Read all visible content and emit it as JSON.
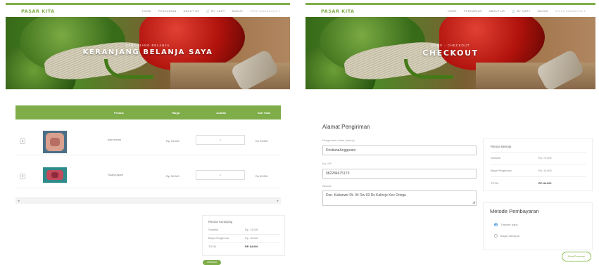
{
  "nav": {
    "brand": "PASAR KITA",
    "items": [
      "HOME",
      "PENCARIAN",
      "ABOUT US",
      "MY CART",
      "MASUK"
    ],
    "user": "KHISTIANAANGGA ▾"
  },
  "cart": {
    "hero_sub": "KERANJANG BELANJA",
    "hero_title": "KERANJANG BELANJA SAYA",
    "columns": [
      "Produk",
      "Harga",
      "Jumlah",
      "Sub Total"
    ],
    "rows": [
      {
        "remove": "x",
        "name": "Ikan merah",
        "price": "Rp. 24.000",
        "qty": "1",
        "subtotal": "Rp 24.000"
      },
      {
        "remove": "x",
        "name": "Tulang ayam",
        "price": "Rp. 50.000",
        "qty": "1",
        "subtotal": "Rp 50.000"
      }
    ],
    "scroll_left": "◂",
    "scroll_right": "▸",
    "summary": {
      "heading": "Rincian Keranjang",
      "rows": [
        {
          "label": "Subtotal",
          "value": "Rp. 74.000"
        },
        {
          "label": "Biaya Pengiriman",
          "value": "Rp. 10.000"
        },
        {
          "label": "TOTAL",
          "value": "RP. 84.000"
        }
      ]
    },
    "checkout_button": "checkout"
  },
  "checkout": {
    "hero_sub": "HOME - CHECKOUT",
    "hero_title": "CHECKOUT",
    "form_title": "Alamat Pengiriman",
    "fields": [
      {
        "label": "Pengiriman untuk (nama):",
        "value": "KristianaAnggarani"
      },
      {
        "label": "No. HP:",
        "value": "082284675170"
      }
    ],
    "address": {
      "label": "Alamat:",
      "value": "Dsn. Kalianwe Rt. 04 Rw 03 Ds Kalirejo Kec Dringu"
    },
    "summary": {
      "heading": "Rincian Belanja",
      "rows": [
        {
          "label": "Subtotal",
          "value": "Rp. 74.000"
        },
        {
          "label": "Biaya Pengiriman",
          "value": "Rp. 10.000"
        },
        {
          "label": "TOTAL",
          "value": "RP. 84.000"
        }
      ]
    },
    "payment_title": "Metode Pembayaran",
    "payment_options": [
      "Transfer bank",
      "Bayar ditempat"
    ],
    "order_button": "Buat Pesanan"
  },
  "colors": {
    "accent": "#7fad4a",
    "radio_selected": "#3a8fe0"
  }
}
